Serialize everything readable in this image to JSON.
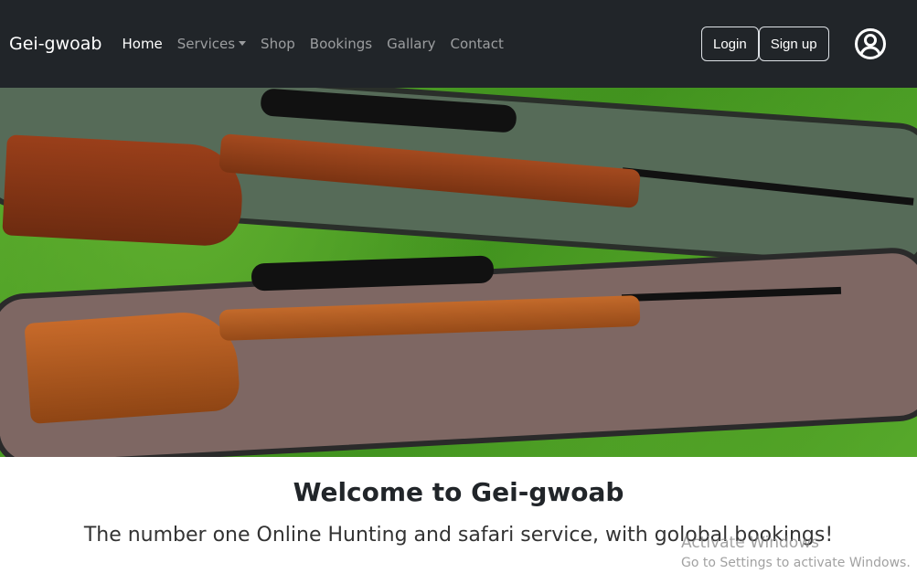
{
  "navbar": {
    "brand": "Gei-gwoab",
    "links": [
      {
        "label": "Home",
        "active": true
      },
      {
        "label": "Services",
        "dropdown": true
      },
      {
        "label": "Shop"
      },
      {
        "label": "Bookings"
      },
      {
        "label": "Gallary"
      },
      {
        "label": "Contact"
      }
    ],
    "login": "Login",
    "signup": "Sign up",
    "user_icon": "user-circle-icon"
  },
  "hero": {
    "alt": "two scoped hunting rifles on gun cases on grass"
  },
  "main": {
    "title": "Welcome to Gei-gwoab",
    "subtitle": "The number one Online Hunting and safari service, with golobal bookings!"
  },
  "watermark": {
    "title": "Activate Windows",
    "text": "Go to Settings to activate Windows."
  },
  "colors": {
    "navbar": "#212529"
  }
}
